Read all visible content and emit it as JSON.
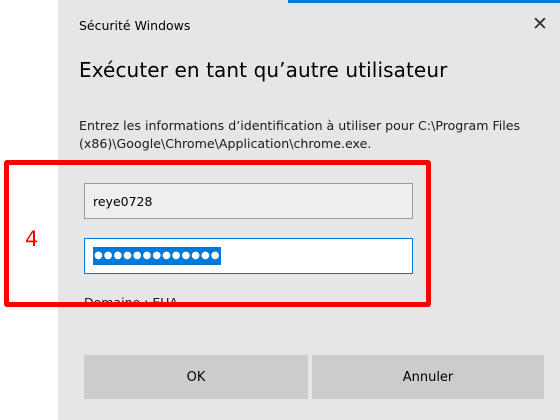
{
  "dialog": {
    "window_title": "Sécurité Windows",
    "heading": "Exécuter en tant qu’autre utilisateur",
    "description": "Entrez les informations d’identification à utiliser pour C:\\Program Files (x86)\\Google\\Chrome\\Application\\chrome.exe.",
    "close_icon": "close-icon",
    "close_glyph": "✕",
    "accent_color": "#0078d7"
  },
  "form": {
    "username_value": "reye0728",
    "password_mask": "●●●●●●●●●●●●●",
    "domain_label": "Domaine : EUA"
  },
  "buttons": {
    "ok_label": "OK",
    "cancel_label": "Annuler"
  },
  "annotation": {
    "step_number": "4",
    "color": "#ff0000"
  }
}
